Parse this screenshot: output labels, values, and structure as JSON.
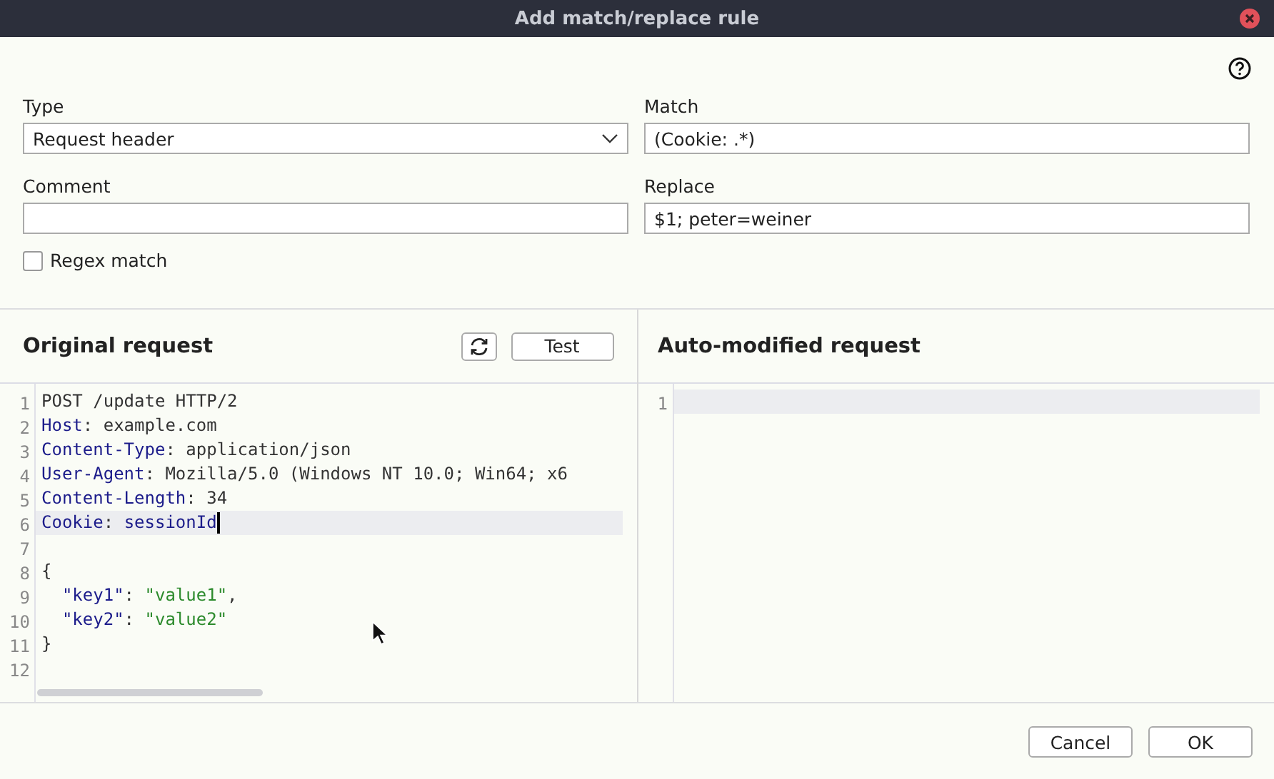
{
  "window": {
    "title": "Add match/replace rule"
  },
  "form": {
    "type": {
      "label": "Type",
      "value": "Request header"
    },
    "match": {
      "label": "Match",
      "value": "(Cookie: .*)"
    },
    "comment": {
      "label": "Comment"
    },
    "replace": {
      "label": "Replace",
      "value": "$1; peter=weiner"
    },
    "regex_match": {
      "label": "Regex match",
      "checked": false
    }
  },
  "original_request": {
    "title": "Original request",
    "test_button": "Test",
    "lines": [
      {
        "number": "1",
        "current": false,
        "caret": false,
        "tokens": [
          {
            "kind": "text",
            "text": "POST /update HTTP/2"
          }
        ]
      },
      {
        "number": "2",
        "current": false,
        "caret": false,
        "tokens": [
          {
            "kind": "name",
            "text": "Host"
          },
          {
            "kind": "text",
            "text": ": example.com"
          }
        ]
      },
      {
        "number": "3",
        "current": false,
        "caret": false,
        "tokens": [
          {
            "kind": "name",
            "text": "Content-Type"
          },
          {
            "kind": "text",
            "text": ": application/json"
          }
        ]
      },
      {
        "number": "4",
        "current": false,
        "caret": false,
        "tokens": [
          {
            "kind": "name",
            "text": "User-Agent"
          },
          {
            "kind": "text",
            "text": ": Mozilla/5.0 (Windows NT 10.0; Win64; x6"
          }
        ]
      },
      {
        "number": "5",
        "current": false,
        "caret": false,
        "tokens": [
          {
            "kind": "name",
            "text": "Content-Length"
          },
          {
            "kind": "text",
            "text": ": 34"
          }
        ]
      },
      {
        "number": "6",
        "current": true,
        "caret": true,
        "tokens": [
          {
            "kind": "name",
            "text": "Cookie"
          },
          {
            "kind": "text",
            "text": ": "
          },
          {
            "kind": "name",
            "text": "sessionId"
          }
        ]
      },
      {
        "number": "7",
        "current": false,
        "caret": false
      },
      {
        "number": "8",
        "current": false,
        "caret": false,
        "tokens": [
          {
            "kind": "text",
            "text": "{"
          }
        ]
      },
      {
        "number": "9",
        "current": false,
        "caret": false,
        "tokens": [
          {
            "kind": "name",
            "text": "  \"key1\""
          },
          {
            "kind": "text",
            "text": ": "
          },
          {
            "kind": "string",
            "text": "\"value1\""
          },
          {
            "kind": "text",
            "text": ","
          }
        ]
      },
      {
        "number": "10",
        "current": false,
        "caret": false,
        "tokens": [
          {
            "kind": "name",
            "text": "  \"key2\""
          },
          {
            "kind": "text",
            "text": ": "
          },
          {
            "kind": "string",
            "text": "\"value2\""
          }
        ]
      },
      {
        "number": "11",
        "current": false,
        "caret": false,
        "tokens": [
          {
            "kind": "text",
            "text": "}"
          }
        ]
      },
      {
        "number": "12",
        "current": false,
        "caret": false
      }
    ]
  },
  "auto_modified_request": {
    "title": "Auto-modified request",
    "lines": [
      {
        "number": "1",
        "current": true,
        "caret": false
      }
    ]
  },
  "buttons": [
    "Cancel",
    "OK"
  ]
}
